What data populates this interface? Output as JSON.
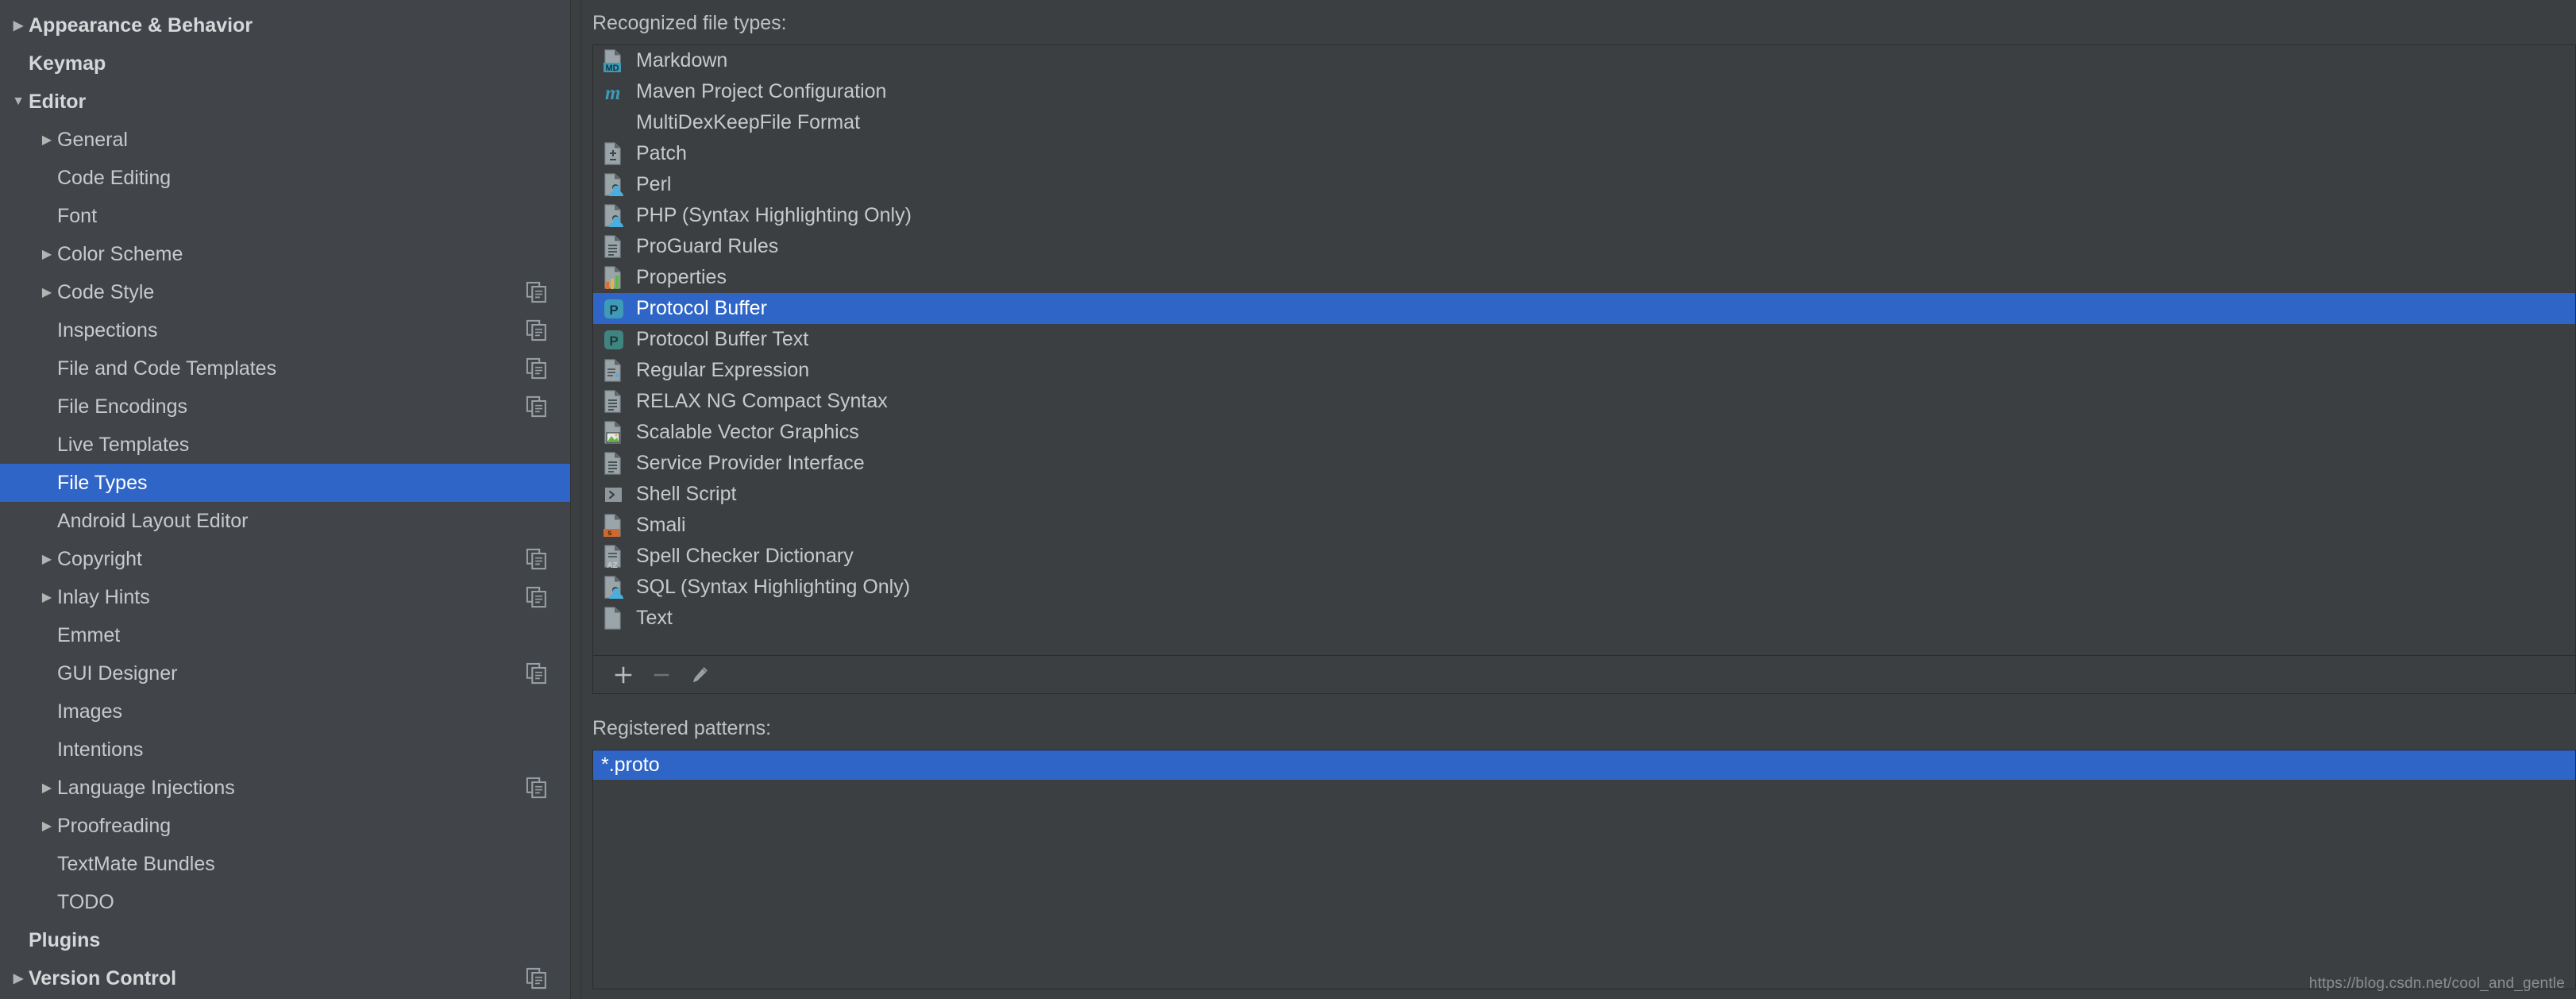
{
  "colors": {
    "selection_blue": "#2f65c7",
    "panel_bg": "#3c3f41",
    "sidebar_bg": "#41454a",
    "text": "#c8c9ca",
    "border": "#2b2b2b",
    "accent_cyan": "#3e9bb8",
    "accent_orange": "#cc7832"
  },
  "sidebar": {
    "items": [
      {
        "label": "Appearance & Behavior",
        "level": 0,
        "arrow": "collapsed",
        "bold": true,
        "copy": false,
        "selected": false
      },
      {
        "label": "Keymap",
        "level": 0,
        "arrow": "none",
        "bold": true,
        "copy": false,
        "selected": false
      },
      {
        "label": "Editor",
        "level": 0,
        "arrow": "expanded",
        "bold": true,
        "copy": false,
        "selected": false
      },
      {
        "label": "General",
        "level": 1,
        "arrow": "collapsed",
        "bold": false,
        "copy": false,
        "selected": false
      },
      {
        "label": "Code Editing",
        "level": 1,
        "arrow": "none",
        "bold": false,
        "copy": false,
        "selected": false
      },
      {
        "label": "Font",
        "level": 1,
        "arrow": "none",
        "bold": false,
        "copy": false,
        "selected": false
      },
      {
        "label": "Color Scheme",
        "level": 1,
        "arrow": "collapsed",
        "bold": false,
        "copy": false,
        "selected": false
      },
      {
        "label": "Code Style",
        "level": 1,
        "arrow": "collapsed",
        "bold": false,
        "copy": true,
        "selected": false
      },
      {
        "label": "Inspections",
        "level": 1,
        "arrow": "none",
        "bold": false,
        "copy": true,
        "selected": false
      },
      {
        "label": "File and Code Templates",
        "level": 1,
        "arrow": "none",
        "bold": false,
        "copy": true,
        "selected": false
      },
      {
        "label": "File Encodings",
        "level": 1,
        "arrow": "none",
        "bold": false,
        "copy": true,
        "selected": false
      },
      {
        "label": "Live Templates",
        "level": 1,
        "arrow": "none",
        "bold": false,
        "copy": false,
        "selected": false
      },
      {
        "label": "File Types",
        "level": 1,
        "arrow": "none",
        "bold": false,
        "copy": false,
        "selected": true
      },
      {
        "label": "Android Layout Editor",
        "level": 1,
        "arrow": "none",
        "bold": false,
        "copy": false,
        "selected": false
      },
      {
        "label": "Copyright",
        "level": 1,
        "arrow": "collapsed",
        "bold": false,
        "copy": true,
        "selected": false
      },
      {
        "label": "Inlay Hints",
        "level": 1,
        "arrow": "collapsed",
        "bold": false,
        "copy": true,
        "selected": false
      },
      {
        "label": "Emmet",
        "level": 1,
        "arrow": "none",
        "bold": false,
        "copy": false,
        "selected": false
      },
      {
        "label": "GUI Designer",
        "level": 1,
        "arrow": "none",
        "bold": false,
        "copy": true,
        "selected": false
      },
      {
        "label": "Images",
        "level": 1,
        "arrow": "none",
        "bold": false,
        "copy": false,
        "selected": false
      },
      {
        "label": "Intentions",
        "level": 1,
        "arrow": "none",
        "bold": false,
        "copy": false,
        "selected": false
      },
      {
        "label": "Language Injections",
        "level": 1,
        "arrow": "collapsed",
        "bold": false,
        "copy": true,
        "selected": false
      },
      {
        "label": "Proofreading",
        "level": 1,
        "arrow": "collapsed",
        "bold": false,
        "copy": false,
        "selected": false
      },
      {
        "label": "TextMate Bundles",
        "level": 1,
        "arrow": "none",
        "bold": false,
        "copy": false,
        "selected": false
      },
      {
        "label": "TODO",
        "level": 1,
        "arrow": "none",
        "bold": false,
        "copy": false,
        "selected": false
      },
      {
        "label": "Plugins",
        "level": 0,
        "arrow": "none",
        "bold": true,
        "copy": false,
        "selected": false
      },
      {
        "label": "Version Control",
        "level": 0,
        "arrow": "collapsed",
        "bold": true,
        "copy": true,
        "selected": false
      }
    ]
  },
  "main": {
    "recognized_label": "Recognized file types:",
    "patterns_label": "Registered patterns:",
    "file_types": [
      {
        "label": "Markdown",
        "icon": "file-md-icon",
        "selected": false
      },
      {
        "label": "Maven Project Configuration",
        "icon": "maven-m-icon",
        "selected": false
      },
      {
        "label": "MultiDexKeepFile Format",
        "icon": "none-icon",
        "selected": false
      },
      {
        "label": "Patch",
        "icon": "file-patch-icon",
        "selected": false
      },
      {
        "label": "Perl",
        "icon": "file-script-icon",
        "selected": false
      },
      {
        "label": "PHP (Syntax Highlighting Only)",
        "icon": "file-script-icon",
        "selected": false
      },
      {
        "label": "ProGuard Rules",
        "icon": "file-lines-icon",
        "selected": false
      },
      {
        "label": "Properties",
        "icon": "file-properties-icon",
        "selected": false
      },
      {
        "label": "Protocol Buffer",
        "icon": "protobuf-p-icon",
        "selected": true
      },
      {
        "label": "Protocol Buffer Text",
        "icon": "protobuf-text-p-icon",
        "selected": false
      },
      {
        "label": "Regular Expression",
        "icon": "file-regex-icon",
        "selected": false
      },
      {
        "label": "RELAX NG Compact Syntax",
        "icon": "file-lines-icon",
        "selected": false
      },
      {
        "label": "Scalable Vector Graphics",
        "icon": "file-image-icon",
        "selected": false
      },
      {
        "label": "Service Provider Interface",
        "icon": "file-lines-icon",
        "selected": false
      },
      {
        "label": "Shell Script",
        "icon": "shell-prompt-icon",
        "selected": false
      },
      {
        "label": "Smali",
        "icon": "file-smali-icon",
        "selected": false
      },
      {
        "label": "Spell Checker Dictionary",
        "icon": "file-az-icon",
        "selected": false
      },
      {
        "label": "SQL (Syntax Highlighting Only)",
        "icon": "file-script-icon",
        "selected": false
      },
      {
        "label": "Text",
        "icon": "file-plain-icon",
        "selected": false
      }
    ],
    "toolbar": {
      "add_label": "+",
      "remove_label": "–",
      "edit_label": "edit"
    },
    "registered_patterns": [
      {
        "value": "*.proto",
        "selected": true
      }
    ]
  },
  "watermark": "https://blog.csdn.net/cool_and_gentle"
}
